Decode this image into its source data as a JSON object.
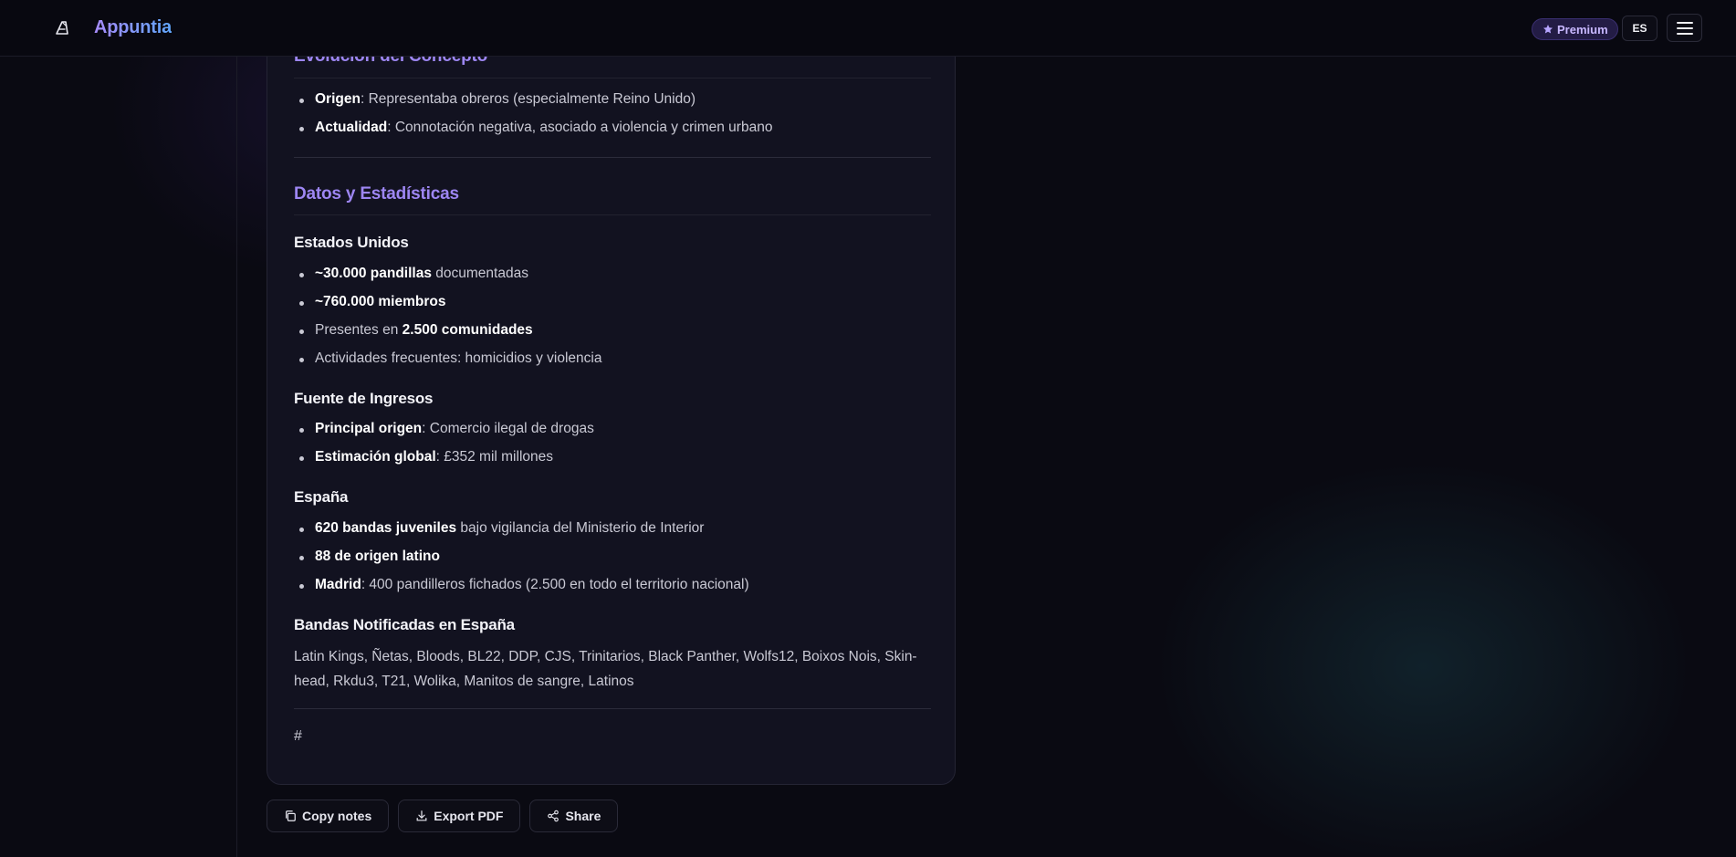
{
  "header": {
    "app_name": "Appuntia",
    "premium_label": "Premium",
    "language": "ES"
  },
  "note": {
    "section1_title": "Evolución del Concepto",
    "section1_items": [
      {
        "bold": "Origen",
        "text": ": Representaba obreros (especialmente Reino Unido)"
      },
      {
        "bold": "Actualidad",
        "text": ": Connotación negativa, asociado a violencia y crimen urbano"
      }
    ],
    "section2_title": "Datos y Estadísticas",
    "usa_title": "Estados Unidos",
    "usa_items": [
      {
        "pre": "",
        "bold": "~30.000 pandillas",
        "text": " documentadas"
      },
      {
        "pre": "",
        "bold": "~760.000 miembros",
        "text": ""
      },
      {
        "pre": "Presentes en ",
        "bold": "2.500 comunidades",
        "text": ""
      },
      {
        "pre": "Actividades frecuentes: homicidios y violencia",
        "bold": "",
        "text": ""
      }
    ],
    "income_title": "Fuente de Ingresos",
    "income_items": [
      {
        "bold": "Principal origen",
        "text": ": Comercio ilegal de drogas"
      },
      {
        "bold": "Estimación global",
        "text": ": £352 mil millones"
      }
    ],
    "spain_title": "España",
    "spain_items": [
      {
        "bold": "620 bandas juveniles",
        "text": " bajo vigilancia del Ministerio de Interior"
      },
      {
        "bold": "88 de origen latino",
        "text": ""
      },
      {
        "bold": "Madrid",
        "text": ": 400 pandilleros fichados (2.500 en todo el territorio nacional)"
      }
    ],
    "bands_title": "Bandas Notificadas en España",
    "bands_text": "Latin Kings, Ñetas, Bloods, BL22, DDP, CJS, Trinitarios, Black Panther, Wolfs12, Boixos Nois, Skin-head, Rkdu3, T21, Wolika, Manitos de sangre, Latinos",
    "trailing_hash": "#"
  },
  "actions": {
    "copy_label": "Copy notes",
    "export_label": "Export PDF",
    "share_label": "Share"
  },
  "icons": {
    "logo": "appuntia-logo-icon",
    "premium": "star-icon",
    "menu": "hamburger-menu-icon",
    "copy": "copy-icon",
    "export": "download-icon",
    "share": "share-icon"
  },
  "colors": {
    "accent": "#9d86f2",
    "background": "#0a0a12",
    "card": "#121220"
  }
}
